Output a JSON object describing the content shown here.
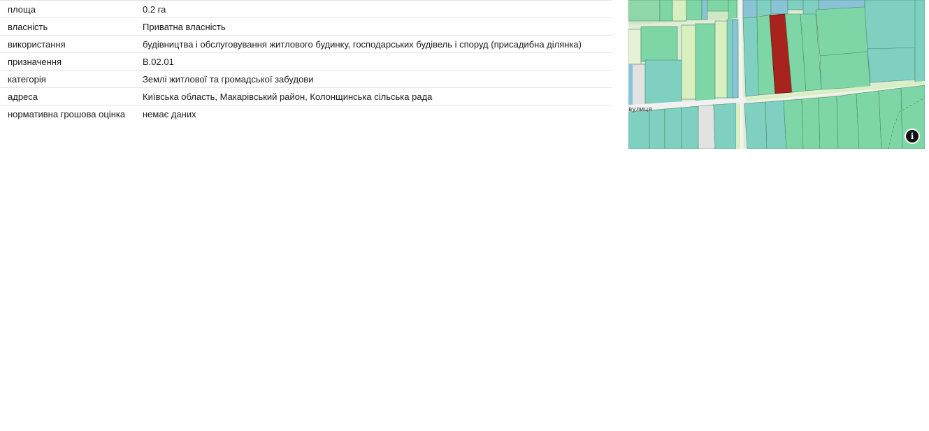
{
  "parcel_info": {
    "rows": [
      {
        "key": "площа",
        "value": "0.2 га"
      },
      {
        "key": "власність",
        "value": "Приватна власність"
      },
      {
        "key": "використання",
        "value": "будівництва і обслуговування житлового будинку, господарських будівель і споруд (присадибна ділянка)"
      },
      {
        "key": "призначення",
        "value": "B.02.01"
      },
      {
        "key": "категорія",
        "value": "Землі житлової та громадської забудови"
      },
      {
        "key": "адреса",
        "value": "Київська область, Макарівський район, Колонщинська сільська рада"
      },
      {
        "key": "нормативна грошова оцінка",
        "value": "немає даних"
      }
    ]
  },
  "map": {
    "street_label": "вулиця",
    "info_icon": "info-icon",
    "colors": {
      "selected_parcel": "#a8231d",
      "parcel_green": "#7ed6a6",
      "parcel_teal": "#7fd0c0",
      "parcel_blue": "#88c3d6",
      "road": "#e6e6e6",
      "light_green": "#d8efc0"
    }
  }
}
